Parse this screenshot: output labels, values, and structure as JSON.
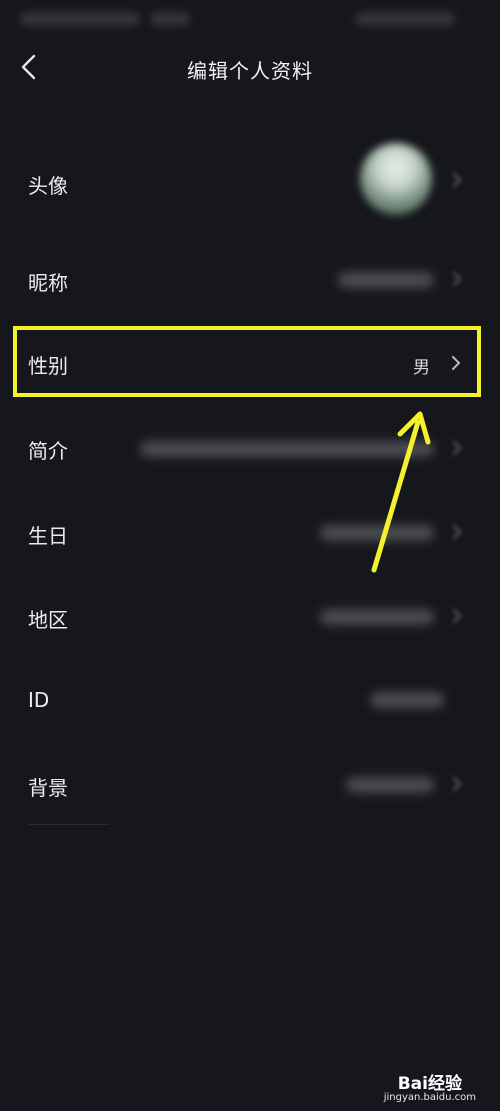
{
  "header": {
    "title": "编辑个人资料"
  },
  "rows": [
    {
      "label": "头像"
    },
    {
      "label": "昵称"
    },
    {
      "label": "性别",
      "value": "男"
    },
    {
      "label": "简介"
    },
    {
      "label": "生日"
    },
    {
      "label": "地区"
    },
    {
      "label": "ID"
    },
    {
      "label": "背景"
    }
  ],
  "colors": {
    "background": "#16171c",
    "highlight": "#f4f22d",
    "arrow": "#f4f22d"
  },
  "icons": {
    "back": "chevron-left-icon",
    "row_arrow": "chevron-right-icon"
  },
  "watermark": {
    "brand": "Bai经验",
    "site": "jingyan.baidu.com"
  }
}
